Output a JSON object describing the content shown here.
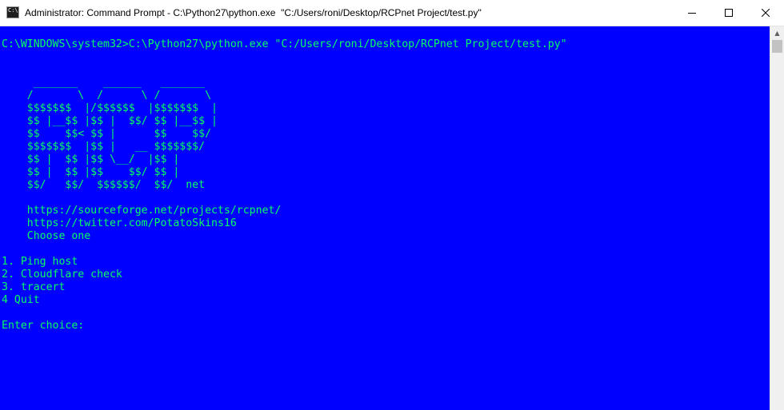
{
  "window": {
    "title": "Administrator: Command Prompt - C:\\Python27\\python.exe  \"C:/Users/roni/Desktop/RCPnet Project/test.py\"",
    "icon_text": "C:\\",
    "icons": {
      "app": "cmd-icon",
      "minimize": "minimize-icon",
      "maximize": "maximize-icon",
      "close": "close-icon"
    }
  },
  "console": {
    "colors": {
      "background": "#0000ff",
      "text": "#00ff60"
    },
    "lines": [
      "C:\\WINDOWS\\system32>C:\\Python27\\python.exe \"C:/Users/roni/Desktop/RCPnet Project/test.py\"",
      "",
      "",
      "     _______    ______   _______",
      "    /       \\  /      \\ /       \\",
      "    $$$$$$$  |/$$$$$$  |$$$$$$$  |",
      "    $$ |__$$ |$$ |  $$/ $$ |__$$ |",
      "    $$    $$< $$ |      $$    $$/",
      "    $$$$$$$  |$$ |   __ $$$$$$$/",
      "    $$ |  $$ |$$ \\__/  |$$ |",
      "    $$ |  $$ |$$    $$/ $$ |",
      "    $$/   $$/  $$$$$$/  $$/  net",
      "",
      "    https://sourceforge.net/projects/rcpnet/",
      "    https://twitter.com/PotatoSkins16",
      "    Choose one",
      "",
      "1. Ping host",
      "2. Cloudflare check",
      "3. tracert",
      "4 Quit",
      "",
      "Enter choice:"
    ]
  }
}
